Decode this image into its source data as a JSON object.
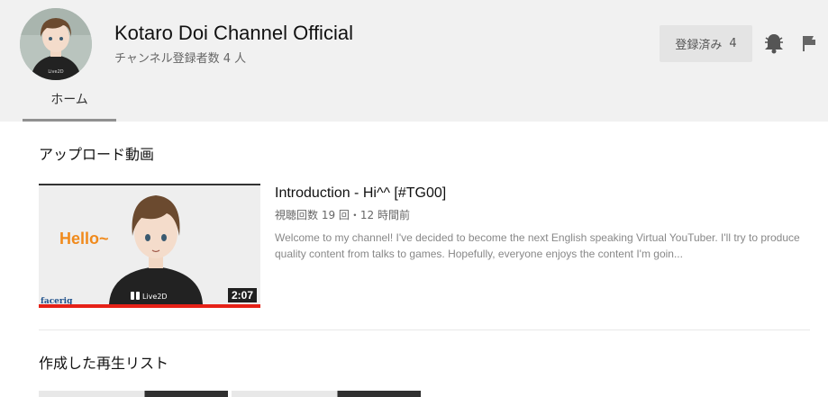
{
  "channel": {
    "name": "Kotaro Doi Channel Official",
    "subscriber_text": "チャンネル登録者数 4 人",
    "avatar_logo": "Live2D"
  },
  "actions": {
    "subscribed_label": "登録済み",
    "subscribed_count": "4",
    "bell_icon": "notification-bell-icon",
    "flag_icon": "report-flag-icon"
  },
  "tabs": [
    {
      "label": "ホーム",
      "active": true
    }
  ],
  "uploads": {
    "section_title": "アップロード動画",
    "video": {
      "title": "Introduction - Hi^^ [#TG00]",
      "meta": "視聴回数 19 回・12 時間前",
      "description": "Welcome to my channel! I've decided to become the next English speaking Virtual YouTuber. I'll try to produce quality content from talks to games. Hopefully, everyone enjoys the content I'm goin...",
      "thumbnail_text": "Hello~",
      "thumbnail_brand": "Live2D",
      "thumbnail_watermark": "facerig",
      "duration": "2:07",
      "watched_fraction": 1.0,
      "progress_color": "#e62117"
    }
  },
  "playlists": {
    "section_title": "作成した再生リスト"
  },
  "colors": {
    "header_bg": "#f1f1f1",
    "accent": "#e62117",
    "button_bg": "#e4e4e4"
  }
}
